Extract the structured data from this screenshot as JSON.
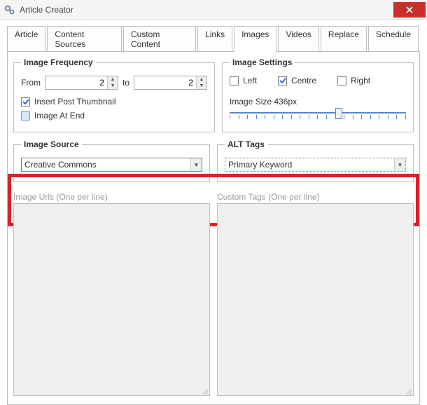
{
  "window": {
    "title": "Article Creator"
  },
  "tabs": [
    {
      "label": "Article"
    },
    {
      "label": "Content Sources"
    },
    {
      "label": "Custom Content"
    },
    {
      "label": "Links"
    },
    {
      "label": "Images",
      "active": true
    },
    {
      "label": "Videos"
    },
    {
      "label": "Replace"
    },
    {
      "label": "Schedule"
    }
  ],
  "frequency": {
    "legend": "Image Frequency",
    "from_label": "From",
    "to_label": "to",
    "from_value": "2",
    "to_value": "2",
    "insert_thumbnail_label": "Insert Post Thumbnail",
    "insert_thumbnail_checked": true,
    "image_at_end_label": "Image At End",
    "image_at_end_checked": false
  },
  "settings": {
    "legend": "Image Settings",
    "left_label": "Left",
    "centre_label": "Centre",
    "right_label": "Right",
    "centre_checked": true,
    "size_label": "Image Size 436px"
  },
  "source": {
    "legend": "Image Source",
    "value": "Creative Commons",
    "urls_label": "Image Urls (One per line)"
  },
  "alt": {
    "legend": "ALT Tags",
    "value": "Primary Keyword",
    "custom_label": "Custom Tags (One per line)"
  }
}
